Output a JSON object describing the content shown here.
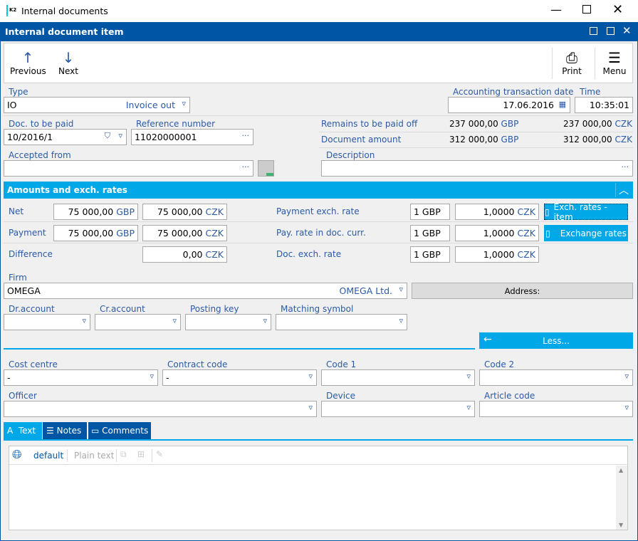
{
  "window": {
    "title": "Internal documents"
  },
  "form": {
    "title": "Internal document item"
  },
  "toolbar": {
    "previous": "Previous",
    "next": "Next",
    "print": "Print",
    "menu": "Menu"
  },
  "type": {
    "label": "Type",
    "code": "IO",
    "name": "Invoice out"
  },
  "accounting_date": {
    "label": "Accounting transaction date",
    "value": "17.06.2016"
  },
  "time": {
    "label": "Time",
    "value": "10:35:01"
  },
  "doc_to_be_paid": {
    "label": "Doc. to be paid",
    "value": "10/2016/1"
  },
  "reference_number": {
    "label": "Reference number",
    "value": "11020000001"
  },
  "remains": {
    "label": "Remains to be paid off",
    "gbp": "237 000,00",
    "gbp_cur": "GBP",
    "czk": "237 000,00",
    "czk_cur": "CZK"
  },
  "doc_amount": {
    "label": "Document amount",
    "gbp": "312 000,00",
    "gbp_cur": "GBP",
    "czk": "312 000,00",
    "czk_cur": "CZK"
  },
  "accepted_from": {
    "label": "Accepted from",
    "value": ""
  },
  "description": {
    "label": "Description",
    "value": ""
  },
  "amounts": {
    "title": "Amounts and exch. rates",
    "net": {
      "label": "Net",
      "gbp": "75 000,00",
      "czk": "75 000,00"
    },
    "payment": {
      "label": "Payment",
      "gbp": "75 000,00",
      "czk": "75 000,00"
    },
    "difference": {
      "label": "Difference",
      "czk": "0,00"
    },
    "gbp": "GBP",
    "czk": "CZK",
    "rates": [
      {
        "label": "Payment exch. rate",
        "qty": "1 GBP",
        "rate": "1,0000"
      },
      {
        "label": "Pay. rate in doc. curr.",
        "qty": "1 GBP",
        "rate": "1,0000"
      },
      {
        "label": "Doc. exch. rate",
        "qty": "1 GBP",
        "rate": "1,0000"
      }
    ],
    "exch_item_button": "Exch. rates - item",
    "exch_button": "Exchange rates"
  },
  "firm": {
    "label": "Firm",
    "code": "OMEGA",
    "name": "OMEGA Ltd.",
    "address_button": "Address:"
  },
  "accounts": {
    "dr": "Dr.account",
    "cr": "Cr.account",
    "posting_key": "Posting key",
    "matching_symbol": "Matching symbol"
  },
  "less_button": "Less...",
  "codes": {
    "cost_centre": {
      "label": "Cost centre",
      "value": "-"
    },
    "contract_code": {
      "label": "Contract code",
      "value": "-"
    },
    "code1": {
      "label": "Code 1",
      "value": ""
    },
    "code2": {
      "label": "Code 2",
      "value": ""
    },
    "officer": {
      "label": "Officer",
      "value": ""
    },
    "device": {
      "label": "Device",
      "value": ""
    },
    "article_code": {
      "label": "Article code",
      "value": ""
    }
  },
  "tabs": [
    {
      "label": "Text",
      "active": true
    },
    {
      "label": "Notes"
    },
    {
      "label": "Comments"
    }
  ],
  "editor": {
    "language": "default",
    "format": "Plain text"
  },
  "colors": {
    "title_bar": "#0055a5",
    "accent": "#00a8e8",
    "label": "#2b5aa6"
  }
}
